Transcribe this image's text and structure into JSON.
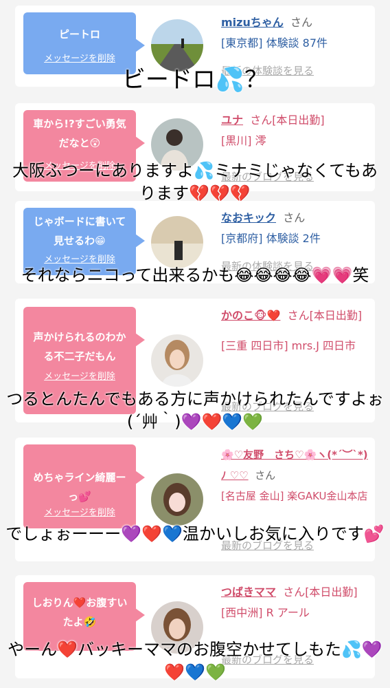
{
  "delete_label": "メッセージを削除",
  "cards": [
    {
      "bubble": "ピートロ",
      "name": "mizuちゃん",
      "san": "さん",
      "detail": "[東京都] 体験談 87件",
      "more": "最新の体験談を見る",
      "overlay": "ビードロ💦？"
    },
    {
      "bubble": "車から!?すごい勇気だなと😲",
      "name": "ユナ",
      "san": "さん[本日出勤]",
      "detail": "[黒川] 澪",
      "more": "最新のブログを見る",
      "overlay": "大阪ふつーにありますよ💦ミナミじゃなくてもあります💔💔💔"
    },
    {
      "bubble": "じゃボードに書いて見せるわ😁",
      "name": "なおキック",
      "san": "さん",
      "detail": "[京都府] 体験談 2件",
      "more": "最新の体験談を見る",
      "overlay": "それならニコって出来るかも😂😂😂😂💗💗笑"
    },
    {
      "bubble": "声かけられるのわかる不二子だもん",
      "name": "かのこ🐵❤️",
      "san": "さん[本日出勤]",
      "detail": "[三重 四日市] mrs.J 四日市",
      "more": "最新のブログを見る",
      "overlay": "つるとんたんでもある方に声かけられたんですよぉ(´艸｀)💜❤️💙💚"
    },
    {
      "bubble": "めちゃライン綺麗ーっ💕",
      "name": "🌸♡友野　さち♡🌸ヽ(*´︶`*)ﾉ ♡♡",
      "san": "さん",
      "detail": "[名古屋 金山] 楽GAKU金山本店",
      "more": "最新のブログを見る",
      "overlay": "でしょぉーーー💜❤️💙温かいしお気に入りです💕"
    },
    {
      "bubble": "しおりん❤️お腹すいたよ🤣",
      "name": "つばきママ",
      "san": "さん[本日出勤]",
      "detail": "[西中洲] R アール",
      "more": "最新のブログを見る",
      "overlay": "やーん❤️バッキーママのお腹空かせてしもた💦💜❤️💙💚"
    }
  ]
}
